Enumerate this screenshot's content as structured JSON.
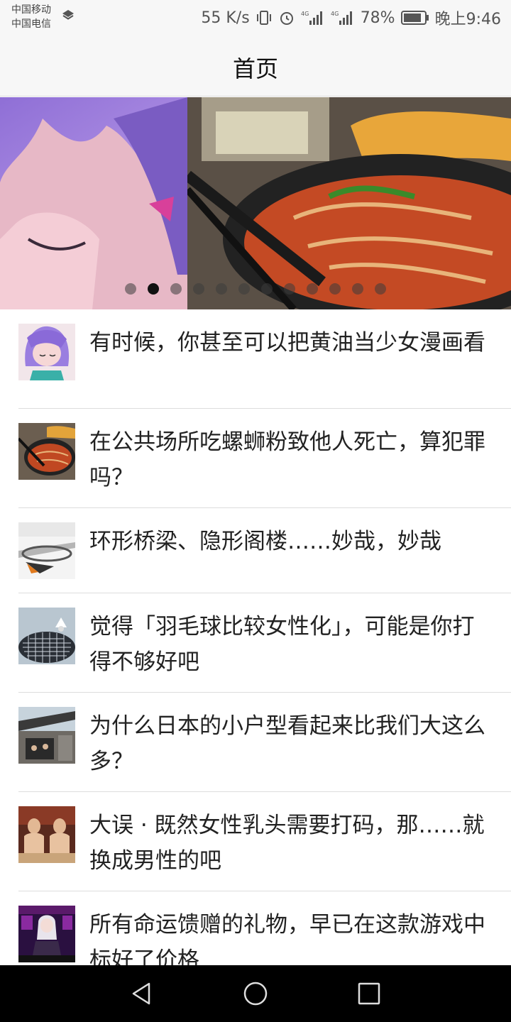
{
  "status_bar": {
    "carrier_1": "中国移动",
    "carrier_2": "中国电信",
    "net_speed": "55 K/s",
    "battery": "78%",
    "time": "晚上9:46"
  },
  "header": {
    "title": "首页"
  },
  "banner": {
    "dot_count": 12,
    "active_index": 1
  },
  "articles": [
    {
      "title": "有时候，你甚至可以把黄油当少女漫画看",
      "thumb": "anime-girl"
    },
    {
      "title": "在公共场所吃螺蛳粉致他人死亡，算犯罪吗？",
      "thumb": "noodle-bowl"
    },
    {
      "title": "环形桥梁、隐形阁楼……妙哉，妙哉",
      "thumb": "ring-bridge"
    },
    {
      "title": "觉得「羽毛球比较女性化」，可能是你打得不够好吧",
      "thumb": "badminton"
    },
    {
      "title": "为什么日本的小户型看起来比我们大这么多？",
      "thumb": "japanese-house"
    },
    {
      "title": "大误 · 既然女性乳头需要打码，那……就换成男性的吧",
      "thumb": "renaissance-painting"
    },
    {
      "title": "所有命运馈赠的礼物，早已在这款游戏中标好了价格",
      "thumb": "game-character"
    }
  ],
  "nav": {
    "back": "back-icon",
    "home": "home-icon",
    "recents": "recents-icon"
  }
}
